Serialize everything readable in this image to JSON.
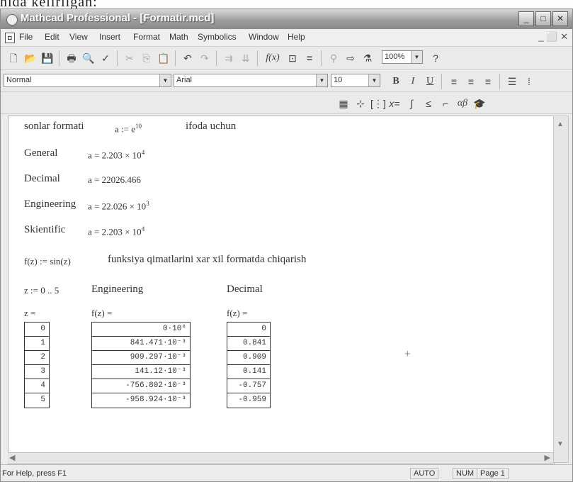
{
  "background": {
    "caption": "nida kelirilgan:"
  },
  "window": {
    "title": "Mathcad Professional - [Formatir.mcd]"
  },
  "menu": [
    "File",
    "Edit",
    "View",
    "Insert",
    "Format",
    "Math",
    "Symbolics",
    "Window",
    "Help"
  ],
  "formatting": {
    "style": "Normal",
    "font": "Arial",
    "size": "10",
    "bold": "B",
    "italic": "I",
    "underline": "U"
  },
  "zoom": "100%",
  "document": {
    "heading_left": "sonlar formati",
    "def_expr": "a := e",
    "def_exp": "10",
    "heading_right": "ifoda uchun",
    "formats": [
      {
        "label": "General",
        "value": "a = 2.203 × 10",
        "exp": "4"
      },
      {
        "label": "Decimal",
        "value": "a = 22026.466",
        "exp": ""
      },
      {
        "label": "Engineering",
        "value": "a = 22.026 × 10",
        "exp": "3"
      },
      {
        "label": "Skientific",
        "value": "a = 2.203 × 10",
        "exp": "4"
      }
    ],
    "func_def": "f(z) := sin(z)",
    "func_text": "funksiya qimatlarini xar xil formatda chiqarish",
    "range_def": "z := 0 .. 5",
    "col_eng_title": "Engineering",
    "col_dec_title": "Decimal",
    "z_label": "z =",
    "fz_label1": "f(z) =",
    "fz_label2": "f(z) =",
    "z_values": [
      "0",
      "1",
      "2",
      "3",
      "4",
      "5"
    ],
    "eng_values": [
      "0·10⁰",
      "841.471·10⁻³",
      "909.297·10⁻³",
      "141.12·10⁻³",
      "-756.802·10⁻³",
      "-958.924·10⁻³"
    ],
    "dec_values": [
      "0",
      "0.841",
      "0.909",
      "0.141",
      "-0.757",
      "-0.959"
    ]
  },
  "status": {
    "message": "For Help, press F1",
    "mode": "AUTO",
    "num": "NUM",
    "page": "Page 1"
  }
}
